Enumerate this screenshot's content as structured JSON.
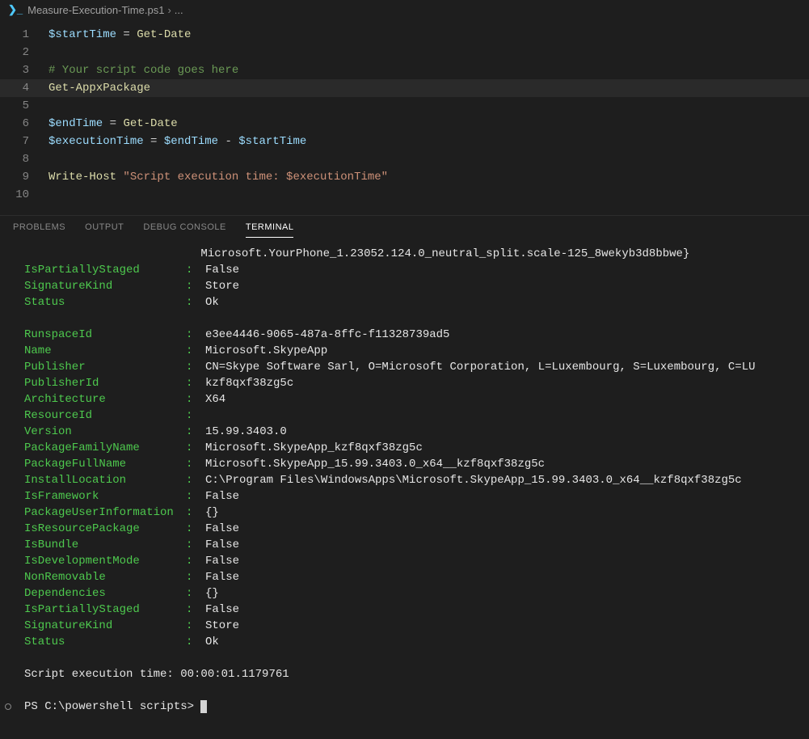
{
  "breadcrumb": {
    "file": "Measure-Execution-Time.ps1",
    "tail": "..."
  },
  "editor": {
    "lines": [
      {
        "n": 1,
        "tokens": [
          [
            "tok-var",
            "$startTime"
          ],
          [
            "tok-op",
            " = "
          ],
          [
            "tok-cmd",
            "Get-Date"
          ]
        ]
      },
      {
        "n": 2,
        "tokens": []
      },
      {
        "n": 3,
        "tokens": [
          [
            "tok-comment",
            "# Your script code goes here"
          ]
        ]
      },
      {
        "n": 4,
        "active": true,
        "tokens": [
          [
            "tok-cmd",
            "Get-AppxPackage"
          ]
        ]
      },
      {
        "n": 5,
        "tokens": []
      },
      {
        "n": 6,
        "tokens": [
          [
            "tok-var",
            "$endTime"
          ],
          [
            "tok-op",
            " = "
          ],
          [
            "tok-cmd",
            "Get-Date"
          ]
        ]
      },
      {
        "n": 7,
        "tokens": [
          [
            "tok-var",
            "$executionTime"
          ],
          [
            "tok-op",
            " = "
          ],
          [
            "tok-var",
            "$endTime"
          ],
          [
            "tok-op",
            " - "
          ],
          [
            "tok-var",
            "$startTime"
          ]
        ]
      },
      {
        "n": 8,
        "tokens": []
      },
      {
        "n": 9,
        "tokens": [
          [
            "tok-cmd",
            "Write-Host"
          ],
          [
            "tok-op",
            " "
          ],
          [
            "tok-str",
            "\"Script execution time: $executionTime\""
          ]
        ]
      },
      {
        "n": 10,
        "tokens": []
      }
    ]
  },
  "panels": {
    "problems": "PROBLEMS",
    "output": "OUTPUT",
    "debug": "DEBUG CONSOLE",
    "terminal": "TERMINAL"
  },
  "terminal_top_line": "                          Microsoft.YourPhone_1.23052.124.0_neutral_split.scale-125_8wekyb3d8bbwe}",
  "block1": [
    {
      "k": "IsPartiallyStaged",
      "v": "False"
    },
    {
      "k": "SignatureKind",
      "v": "Store"
    },
    {
      "k": "Status",
      "v": "Ok"
    }
  ],
  "block2": [
    {
      "k": "RunspaceId",
      "v": "e3ee4446-9065-487a-8ffc-f11328739ad5"
    },
    {
      "k": "Name",
      "v": "Microsoft.SkypeApp"
    },
    {
      "k": "Publisher",
      "v": "CN=Skype Software Sarl, O=Microsoft Corporation, L=Luxembourg, S=Luxembourg, C=LU"
    },
    {
      "k": "PublisherId",
      "v": "kzf8qxf38zg5c"
    },
    {
      "k": "Architecture",
      "v": "X64"
    },
    {
      "k": "ResourceId",
      "v": ""
    },
    {
      "k": "Version",
      "v": "15.99.3403.0"
    },
    {
      "k": "PackageFamilyName",
      "v": "Microsoft.SkypeApp_kzf8qxf38zg5c"
    },
    {
      "k": "PackageFullName",
      "v": "Microsoft.SkypeApp_15.99.3403.0_x64__kzf8qxf38zg5c"
    },
    {
      "k": "InstallLocation",
      "v": "C:\\Program Files\\WindowsApps\\Microsoft.SkypeApp_15.99.3403.0_x64__kzf8qxf38zg5c"
    },
    {
      "k": "IsFramework",
      "v": "False"
    },
    {
      "k": "PackageUserInformation",
      "v": "{}"
    },
    {
      "k": "IsResourcePackage",
      "v": "False"
    },
    {
      "k": "IsBundle",
      "v": "False"
    },
    {
      "k": "IsDevelopmentMode",
      "v": "False"
    },
    {
      "k": "NonRemovable",
      "v": "False"
    },
    {
      "k": "Dependencies",
      "v": "{}"
    },
    {
      "k": "IsPartiallyStaged",
      "v": "False"
    },
    {
      "k": "SignatureKind",
      "v": "Store"
    },
    {
      "k": "Status",
      "v": "Ok"
    }
  ],
  "exec_line": "Script execution time: 00:00:01.1179761",
  "prompt": "PS C:\\powershell scripts> "
}
